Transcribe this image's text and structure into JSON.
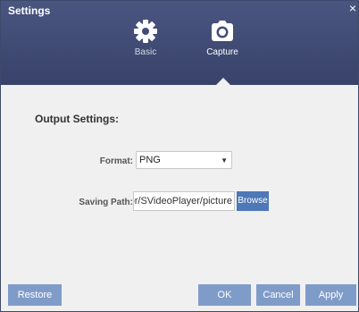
{
  "window": {
    "title": "Settings",
    "close_glyph": "×"
  },
  "tabs": [
    {
      "label": "Basic",
      "icon": "gear-icon",
      "active": false
    },
    {
      "label": "Capture",
      "icon": "camera-icon",
      "active": true
    }
  ],
  "output_settings": {
    "heading": "Output Settings:",
    "format": {
      "label": "Format:",
      "value": "PNG"
    },
    "saving_path": {
      "label": "Saving Path:",
      "value": "or/SVideoPlayer/picture",
      "browse_label": "Browse"
    }
  },
  "buttons": {
    "restore": "Restore",
    "ok": "OK",
    "cancel": "Cancel",
    "apply": "Apply"
  },
  "colors": {
    "header": "#3f4a74",
    "button": "#7f9cc9",
    "browse": "#4e78b6",
    "background": "#f0f0f0"
  }
}
